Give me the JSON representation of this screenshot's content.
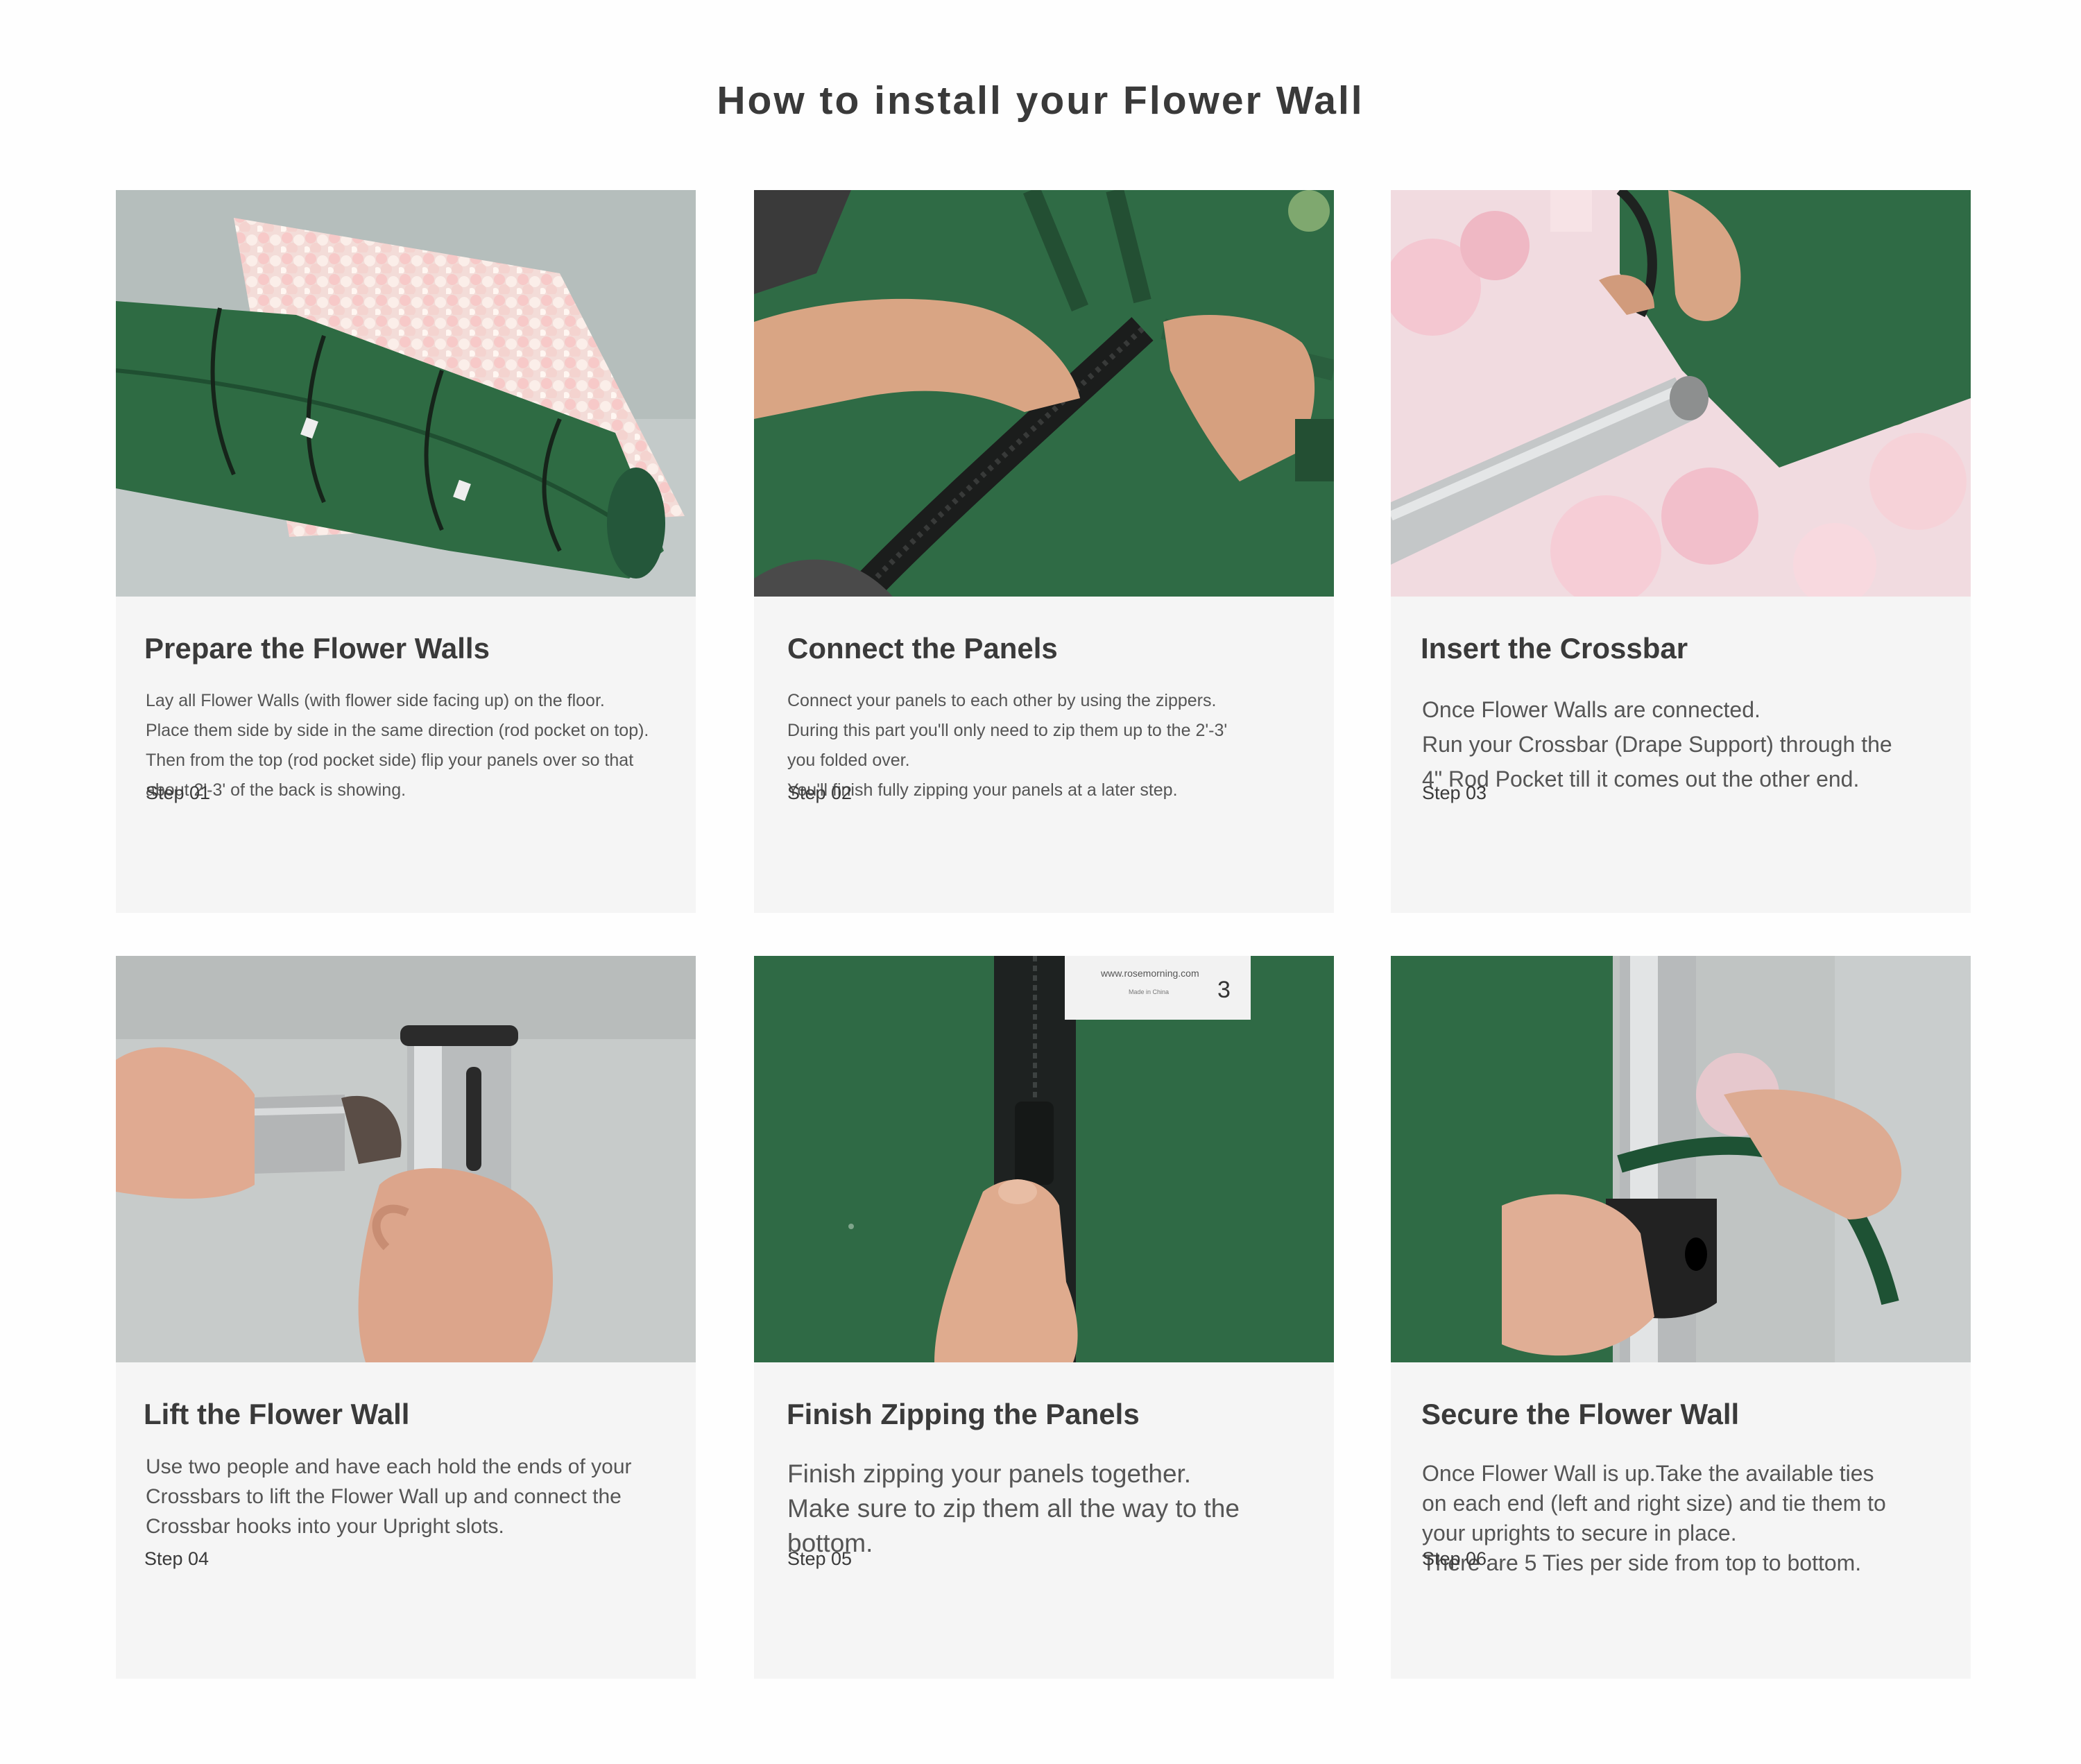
{
  "page": {
    "title": "How to install your Flower Wall"
  },
  "colors": {
    "canvas_green": "#2f6b45",
    "card_bg": "#f5f5f5",
    "text": "#3a3a3a"
  },
  "steps": [
    {
      "heading": "Prepare the Flower Walls",
      "description": "Lay all Flower Walls (with flower side facing up) on the floor.\nPlace them side by side in the same direction (rod pocket on top).\nThen from the top (rod pocket side) flip your panels over so that\nabout 2'-3' of the back is showing.",
      "step_label": "Step 01",
      "photo": "rolled-flower-walls-photo"
    },
    {
      "heading": "Connect the Panels",
      "description": "Connect your panels to each other by using the zippers.\nDuring this part you'll only need to zip them up to the 2'-3'\nyou folded over.\nYou'll finish fully zipping your panels at a later step.",
      "step_label": "Step 02",
      "photo": "zipping-panels-photo"
    },
    {
      "heading": "Insert the Crossbar",
      "description": "Once Flower Walls are connected.\nRun your Crossbar (Drape Support) through the\n4\" Rod Pocket till it comes out the other end.",
      "step_label": "Step 03",
      "photo": "crossbar-rod-pocket-photo"
    },
    {
      "heading": "Lift the Flower Wall",
      "description": "Use two people and have each hold the ends of your\nCrossbars to lift the Flower Wall up and connect the\nCrossbar hooks into your Upright slots.",
      "step_label": "Step 04",
      "photo": "crossbar-hook-upright-photo"
    },
    {
      "heading": "Finish Zipping the Panels",
      "description": "Finish zipping your panels together.\nMake sure to zip them all the way to the\nbottom.",
      "step_label": "Step 05",
      "photo": "finish-zipping-photo",
      "tag_text": "www.rosemorning.com",
      "tag_subtext": "Made in China",
      "tag_number": "3"
    },
    {
      "heading": "Secure the Flower Wall",
      "description": "Once Flower Wall is up.Take the available ties\non each end (left and right size) and tie them to\nyour uprights to secure in place.\nThere are 5 Ties per side from top to bottom.",
      "step_label": "Step 06",
      "photo": "tie-to-upright-photo"
    }
  ]
}
